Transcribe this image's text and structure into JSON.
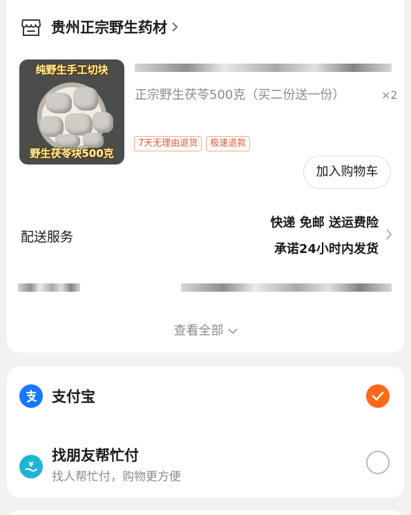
{
  "shop": {
    "name": "贵州正宗野生药材",
    "icon": "store-icon"
  },
  "product": {
    "thumb_top_text": "纯野生手工切块",
    "thumb_bottom_text": "野生茯苓块500克",
    "title": "正宗野生茯苓500克（买二份送一份）",
    "quantity": "×2",
    "tags": [
      "7天无理由退货",
      "极速退款"
    ],
    "add_to_cart": "加入购物车"
  },
  "delivery": {
    "label": "配送服务",
    "line1": "快递 免邮 送运费险",
    "line2": "承诺24小时内发货"
  },
  "view_all": "查看全部",
  "payment": {
    "alipay": {
      "name": "支付宝",
      "icon": "alipay-icon",
      "selected": true
    },
    "friend_pay": {
      "name": "找朋友帮忙付",
      "subtitle": "找人帮忙付，购物更方便",
      "icon": "friend-pay-icon",
      "selected": false
    }
  },
  "colors": {
    "accent": "#ff6a1a",
    "alipay_blue": "#1677ff",
    "tag_red": "#e0562a"
  }
}
